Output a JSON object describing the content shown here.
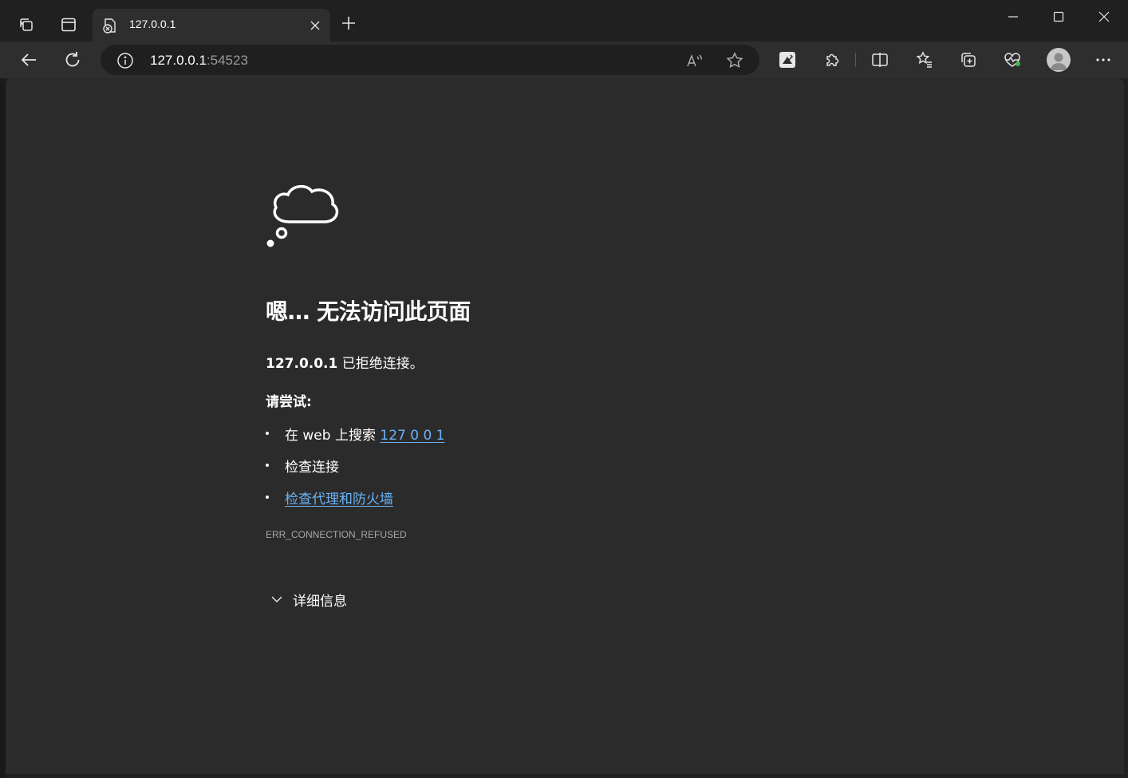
{
  "tab": {
    "title": "127.0.0.1"
  },
  "address_bar": {
    "host": "127.0.0.1",
    "port": ":54523"
  },
  "error_page": {
    "title": "嗯… 无法访问此页面",
    "summary_host": "127.0.0.1",
    "summary_text": " 已拒绝连接。",
    "try_heading": "请尝试:",
    "suggestions": [
      {
        "prefix": "在 web 上搜索 ",
        "link": "127 0 0 1"
      },
      {
        "text": "检查连接"
      },
      {
        "link": "检查代理和防火墙"
      }
    ],
    "error_code": "ERR_CONNECTION_REFUSED",
    "details_label": "详细信息"
  },
  "colors": {
    "frame": "#202020",
    "toolbar": "#2e2e2e",
    "page_bg": "#2b2b2b",
    "link": "#6ab2f5",
    "muted_text": "#a6a6a6"
  }
}
